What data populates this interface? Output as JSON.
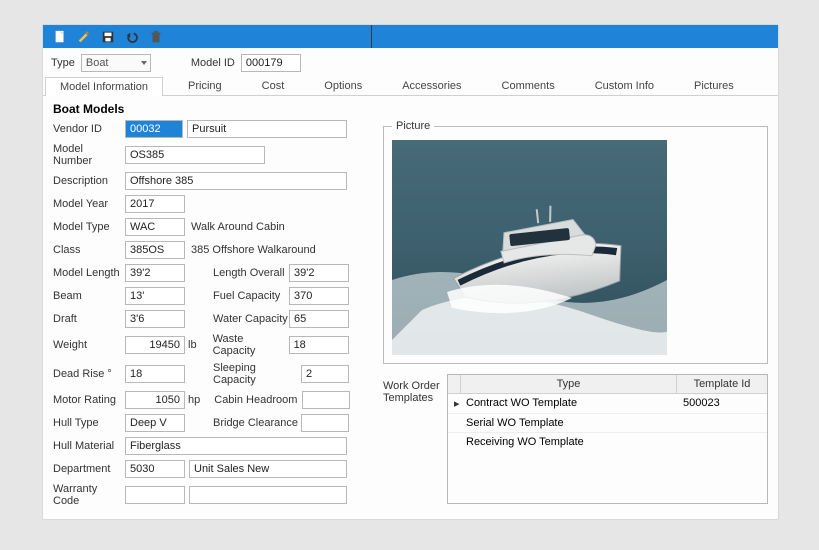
{
  "toolbar": {
    "icons": [
      "new",
      "edit",
      "save",
      "undo",
      "delete"
    ]
  },
  "filter": {
    "type_label": "Type",
    "type_value": "Boat",
    "model_id_label": "Model ID",
    "model_id_value": "000179"
  },
  "tabs": [
    "Model Information",
    "Pricing",
    "Cost",
    "Options",
    "Accessories",
    "Comments",
    "Custom Info",
    "Pictures"
  ],
  "active_tab": 0,
  "section_title": "Boat Models",
  "fields": {
    "vendor_id": {
      "label": "Vendor ID",
      "value": "00032",
      "desc": "Pursuit"
    },
    "model_number": {
      "label": "Model Number",
      "value": "OS385"
    },
    "description": {
      "label": "Description",
      "value": "Offshore 385"
    },
    "model_year": {
      "label": "Model Year",
      "value": "2017"
    },
    "model_type": {
      "label": "Model Type",
      "value": "WAC",
      "desc": "Walk Around Cabin"
    },
    "class": {
      "label": "Class",
      "value": "385OS",
      "desc": "385 Offshore Walkaround"
    },
    "model_length": {
      "label": "Model Length",
      "value": "39'2"
    },
    "length_overall": {
      "label": "Length Overall",
      "value": "39'2"
    },
    "beam": {
      "label": "Beam",
      "value": "13'"
    },
    "fuel_capacity": {
      "label": "Fuel Capacity",
      "value": "370"
    },
    "draft": {
      "label": "Draft",
      "value": "3'6"
    },
    "water_capacity": {
      "label": "Water Capacity",
      "value": "65"
    },
    "weight": {
      "label": "Weight",
      "value": "19450",
      "unit": "lb"
    },
    "waste_capacity": {
      "label": "Waste Capacity",
      "value": "18"
    },
    "dead_rise": {
      "label": "Dead Rise",
      "degree": "°",
      "value": "18"
    },
    "sleeping_capacity": {
      "label": "Sleeping Capacity",
      "value": "2"
    },
    "motor_rating": {
      "label": "Motor Rating",
      "value": "1050",
      "unit": "hp"
    },
    "cabin_headroom": {
      "label": "Cabin Headroom",
      "value": ""
    },
    "hull_type": {
      "label": "Hull Type",
      "value": "Deep V"
    },
    "bridge_clearance": {
      "label": "Bridge Clearance",
      "value": ""
    },
    "hull_material": {
      "label": "Hull Material",
      "value": "Fiberglass"
    },
    "department": {
      "label": "Department",
      "value": "5030",
      "desc": "Unit Sales New"
    },
    "warranty_code": {
      "label": "Warranty Code",
      "value": ""
    }
  },
  "picture_label": "Picture",
  "wo": {
    "label": "Work Order Templates",
    "columns": [
      "Type",
      "Template Id"
    ],
    "rows": [
      {
        "ptr": "▸",
        "type": "Contract WO Template",
        "tid": "500023"
      },
      {
        "ptr": "",
        "type": "Serial WO Template",
        "tid": ""
      },
      {
        "ptr": "",
        "type": "Receiving WO Template",
        "tid": ""
      }
    ]
  }
}
